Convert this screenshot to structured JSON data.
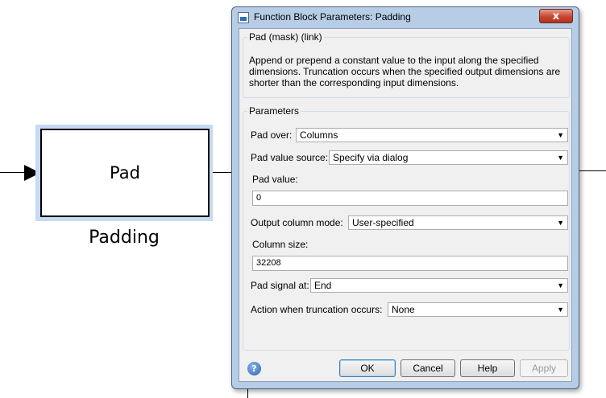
{
  "canvas": {
    "block_label": "Pad",
    "block_caption": "Padding"
  },
  "dialog": {
    "title": "Function Block Parameters: Padding",
    "close_label": "x",
    "mask_group_title": "Pad (mask) (link)",
    "description": "Append or prepend a constant value to the input along the specified dimensions.  Truncation occurs when the specified output dimensions are shorter than the corresponding input dimensions.",
    "params_group_title": "Parameters",
    "pad_over": {
      "label": "Pad over:",
      "value": "Columns"
    },
    "pad_value_source": {
      "label": "Pad value source:",
      "value": "Specify via dialog"
    },
    "pad_value": {
      "label": "Pad value:",
      "value": "0"
    },
    "output_column_mode": {
      "label": "Output column mode:",
      "value": "User-specified"
    },
    "column_size": {
      "label": "Column size:",
      "value": "32208"
    },
    "pad_signal_at": {
      "label": "Pad signal at:",
      "value": "End"
    },
    "truncation_action": {
      "label": "Action when truncation occurs:",
      "value": "None"
    },
    "help_glyph": "?",
    "buttons": {
      "ok": "OK",
      "cancel": "Cancel",
      "help": "Help",
      "apply": "Apply"
    }
  },
  "colors": {
    "selection_highlight": "#c6daf2",
    "dialog_frame": "#b7cde6",
    "close_button": "#c8462f"
  }
}
